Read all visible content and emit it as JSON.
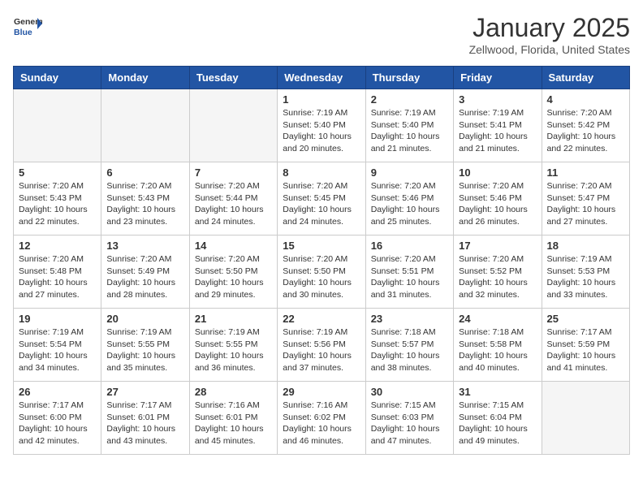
{
  "header": {
    "logo_general": "General",
    "logo_blue": "Blue",
    "month_title": "January 2025",
    "location": "Zellwood, Florida, United States"
  },
  "days_of_week": [
    "Sunday",
    "Monday",
    "Tuesday",
    "Wednesday",
    "Thursday",
    "Friday",
    "Saturday"
  ],
  "weeks": [
    [
      {
        "day": "",
        "empty": true
      },
      {
        "day": "",
        "empty": true
      },
      {
        "day": "",
        "empty": true
      },
      {
        "day": "1",
        "sunrise": "7:19 AM",
        "sunset": "5:40 PM",
        "daylight": "10 hours and 20 minutes."
      },
      {
        "day": "2",
        "sunrise": "7:19 AM",
        "sunset": "5:40 PM",
        "daylight": "10 hours and 21 minutes."
      },
      {
        "day": "3",
        "sunrise": "7:19 AM",
        "sunset": "5:41 PM",
        "daylight": "10 hours and 21 minutes."
      },
      {
        "day": "4",
        "sunrise": "7:20 AM",
        "sunset": "5:42 PM",
        "daylight": "10 hours and 22 minutes."
      }
    ],
    [
      {
        "day": "5",
        "sunrise": "7:20 AM",
        "sunset": "5:43 PM",
        "daylight": "10 hours and 22 minutes."
      },
      {
        "day": "6",
        "sunrise": "7:20 AM",
        "sunset": "5:43 PM",
        "daylight": "10 hours and 23 minutes."
      },
      {
        "day": "7",
        "sunrise": "7:20 AM",
        "sunset": "5:44 PM",
        "daylight": "10 hours and 24 minutes."
      },
      {
        "day": "8",
        "sunrise": "7:20 AM",
        "sunset": "5:45 PM",
        "daylight": "10 hours and 24 minutes."
      },
      {
        "day": "9",
        "sunrise": "7:20 AM",
        "sunset": "5:46 PM",
        "daylight": "10 hours and 25 minutes."
      },
      {
        "day": "10",
        "sunrise": "7:20 AM",
        "sunset": "5:46 PM",
        "daylight": "10 hours and 26 minutes."
      },
      {
        "day": "11",
        "sunrise": "7:20 AM",
        "sunset": "5:47 PM",
        "daylight": "10 hours and 27 minutes."
      }
    ],
    [
      {
        "day": "12",
        "sunrise": "7:20 AM",
        "sunset": "5:48 PM",
        "daylight": "10 hours and 27 minutes."
      },
      {
        "day": "13",
        "sunrise": "7:20 AM",
        "sunset": "5:49 PM",
        "daylight": "10 hours and 28 minutes."
      },
      {
        "day": "14",
        "sunrise": "7:20 AM",
        "sunset": "5:50 PM",
        "daylight": "10 hours and 29 minutes."
      },
      {
        "day": "15",
        "sunrise": "7:20 AM",
        "sunset": "5:50 PM",
        "daylight": "10 hours and 30 minutes."
      },
      {
        "day": "16",
        "sunrise": "7:20 AM",
        "sunset": "5:51 PM",
        "daylight": "10 hours and 31 minutes."
      },
      {
        "day": "17",
        "sunrise": "7:20 AM",
        "sunset": "5:52 PM",
        "daylight": "10 hours and 32 minutes."
      },
      {
        "day": "18",
        "sunrise": "7:19 AM",
        "sunset": "5:53 PM",
        "daylight": "10 hours and 33 minutes."
      }
    ],
    [
      {
        "day": "19",
        "sunrise": "7:19 AM",
        "sunset": "5:54 PM",
        "daylight": "10 hours and 34 minutes."
      },
      {
        "day": "20",
        "sunrise": "7:19 AM",
        "sunset": "5:55 PM",
        "daylight": "10 hours and 35 minutes."
      },
      {
        "day": "21",
        "sunrise": "7:19 AM",
        "sunset": "5:55 PM",
        "daylight": "10 hours and 36 minutes."
      },
      {
        "day": "22",
        "sunrise": "7:19 AM",
        "sunset": "5:56 PM",
        "daylight": "10 hours and 37 minutes."
      },
      {
        "day": "23",
        "sunrise": "7:18 AM",
        "sunset": "5:57 PM",
        "daylight": "10 hours and 38 minutes."
      },
      {
        "day": "24",
        "sunrise": "7:18 AM",
        "sunset": "5:58 PM",
        "daylight": "10 hours and 40 minutes."
      },
      {
        "day": "25",
        "sunrise": "7:17 AM",
        "sunset": "5:59 PM",
        "daylight": "10 hours and 41 minutes."
      }
    ],
    [
      {
        "day": "26",
        "sunrise": "7:17 AM",
        "sunset": "6:00 PM",
        "daylight": "10 hours and 42 minutes."
      },
      {
        "day": "27",
        "sunrise": "7:17 AM",
        "sunset": "6:01 PM",
        "daylight": "10 hours and 43 minutes."
      },
      {
        "day": "28",
        "sunrise": "7:16 AM",
        "sunset": "6:01 PM",
        "daylight": "10 hours and 45 minutes."
      },
      {
        "day": "29",
        "sunrise": "7:16 AM",
        "sunset": "6:02 PM",
        "daylight": "10 hours and 46 minutes."
      },
      {
        "day": "30",
        "sunrise": "7:15 AM",
        "sunset": "6:03 PM",
        "daylight": "10 hours and 47 minutes."
      },
      {
        "day": "31",
        "sunrise": "7:15 AM",
        "sunset": "6:04 PM",
        "daylight": "10 hours and 49 minutes."
      },
      {
        "day": "",
        "empty": true
      }
    ]
  ]
}
